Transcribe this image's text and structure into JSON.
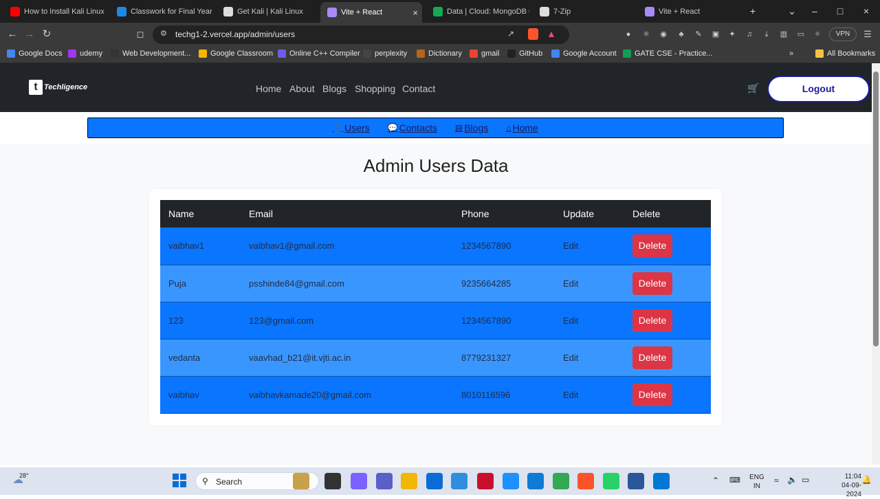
{
  "browser": {
    "tabs": [
      {
        "title": "How to Install Kali Linux in",
        "icon": "youtube-icon",
        "color": "#ff0000"
      },
      {
        "title": "Classwork for Final Year C",
        "icon": "classroom-icon",
        "color": "#1e88e5"
      },
      {
        "title": "Get Kali | Kali Linux",
        "icon": "kali-icon",
        "color": "#dddddd"
      },
      {
        "title": "Vite + React",
        "icon": "vite-icon",
        "color": "#a78bfa",
        "active": true
      },
      {
        "title": "Data | Cloud: MongoDB C",
        "icon": "mongodb-icon",
        "color": "#13aa52"
      },
      {
        "title": "7-Zip",
        "icon": "7zip-icon",
        "color": "#dddddd"
      },
      {
        "title": "Vite + React",
        "icon": "vite-icon",
        "color": "#a78bfa"
      }
    ],
    "url": "techg1-2.vercel.app/admin/users",
    "vpn_label": "VPN",
    "bookmarks": [
      {
        "label": "Google Docs",
        "color": "#4285f4"
      },
      {
        "label": "udemy",
        "color": "#a435f0"
      },
      {
        "label": "Web Development...",
        "color": "#333333"
      },
      {
        "label": "Google Classroom",
        "color": "#f4b400"
      },
      {
        "label": "Online C++ Compiler",
        "color": "#6c5ce7"
      },
      {
        "label": "perplexity",
        "color": "#444444"
      },
      {
        "label": "Dictionary",
        "color": "#b5651d"
      },
      {
        "label": "gmail",
        "color": "#ea4335"
      },
      {
        "label": "GitHub",
        "color": "#222222"
      },
      {
        "label": "Google Account",
        "color": "#4285f4"
      },
      {
        "label": "GATE CSE - Practice...",
        "color": "#0f9d58"
      }
    ],
    "all_bookmarks": "All Bookmarks"
  },
  "site": {
    "logo_text": "Techligence",
    "nav": [
      "Home",
      "About",
      "Blogs",
      "Shopping",
      "Contact"
    ],
    "logout": "Logout",
    "admin_nav": [
      {
        "label": "Users",
        "icon": "user-icon"
      },
      {
        "label": "Contacts",
        "icon": "message-icon"
      },
      {
        "label": "Blogs",
        "icon": "list-icon"
      },
      {
        "label": "Home",
        "icon": "home-icon"
      }
    ],
    "page_title": "Admin Users Data",
    "table": {
      "headers": [
        "Name",
        "Email",
        "Phone",
        "Update",
        "Delete"
      ],
      "rows": [
        {
          "name": "vaibhav1",
          "email": "vaibhav1@gmail.com",
          "phone": "1234567890",
          "update": "Edit",
          "delete": "Delete"
        },
        {
          "name": "Puja",
          "email": "psshinde84@gmail.com",
          "phone": "9235664285",
          "update": "Edit",
          "delete": "Delete"
        },
        {
          "name": "123",
          "email": "123@gmail.com",
          "phone": "1234567890",
          "update": "Edit",
          "delete": "Delete"
        },
        {
          "name": "vedanta",
          "email": "vaavhad_b21@it.vjti.ac.in",
          "phone": "8779231327",
          "update": "Edit",
          "delete": "Delete"
        },
        {
          "name": "vaibhav",
          "email": "vaibhavkamade20@gmail.com",
          "phone": "8010116596",
          "update": "Edit",
          "delete": "Delete"
        }
      ]
    }
  },
  "taskbar": {
    "weather": "28°",
    "search_placeholder": "Search",
    "lang": "ENG",
    "region": "IN",
    "time": "11:04",
    "date": "04-09-2024"
  }
}
